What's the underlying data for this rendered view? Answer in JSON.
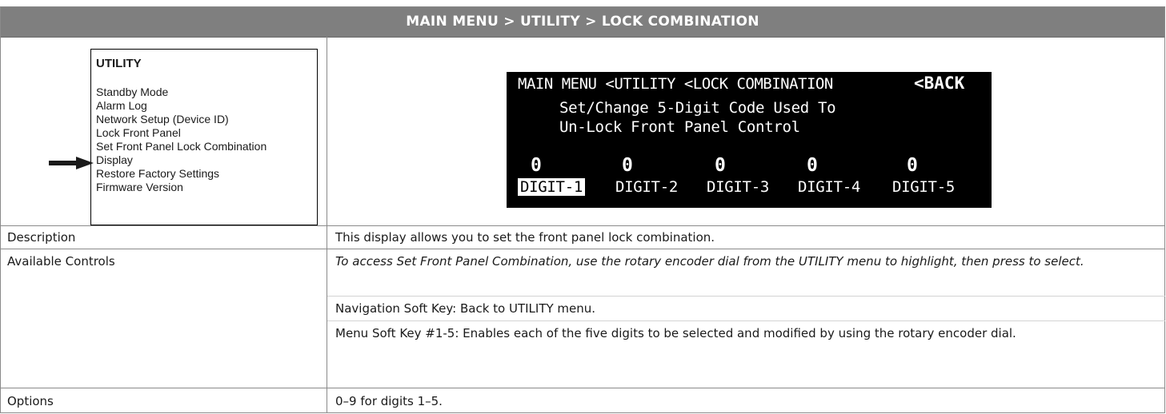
{
  "header": {
    "title": "MAIN MENU > UTILITY > LOCK COMBINATION"
  },
  "menu": {
    "title": "UTILITY",
    "items": [
      "Standby Mode",
      "Alarm Log",
      "Network Setup (Device ID)",
      "Lock Front Panel",
      "Set Front Panel Lock Combination",
      "Display",
      "Restore Factory Settings",
      "Firmware Version"
    ],
    "selected_index": 4,
    "pointer_icon": "arrow-right-icon"
  },
  "screen": {
    "breadcrumb": "MAIN MENU <UTILITY <LOCK COMBINATION",
    "back_label": "<BACK",
    "line1": "Set/Change 5-Digit Code Used To",
    "line2": "Un-Lock Front Panel Control",
    "digit_values": [
      "0",
      "0",
      "0",
      "0",
      "0"
    ],
    "digit_labels": [
      "DIGIT-1",
      "DIGIT-2",
      "DIGIT-3",
      "DIGIT-4",
      "DIGIT-5"
    ],
    "selected_digit": 0
  },
  "rows": {
    "description": {
      "label": "Description",
      "text": "This display allows you to set the front panel lock combination."
    },
    "controls": {
      "label": "Available Controls",
      "intro": "To access Set Front Panel Combination, use the rotary encoder dial from the UTILITY menu to highlight, then press to select.",
      "nav": "Navigation Soft Key: Back to UTILITY menu.",
      "menu": "Menu Soft Key #1-5: Enables each of the five digits to be selected and modified by using the rotary encoder dial."
    },
    "options": {
      "label": "Options",
      "text": "0–9 for digits 1–5."
    }
  },
  "colors": {
    "header_bg": "#7f7f7f",
    "lcd_bg": "#000000",
    "lcd_fg": "#ffffff"
  }
}
